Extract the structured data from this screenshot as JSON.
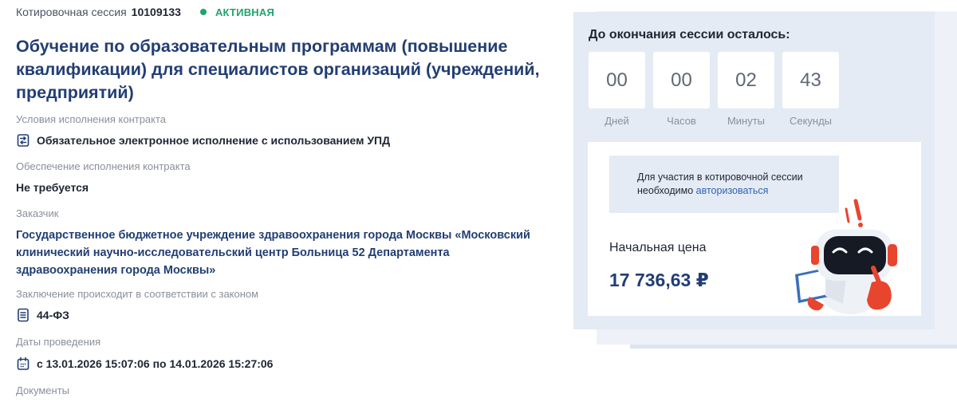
{
  "session": {
    "label": "Котировочная сессия",
    "number": "10109133",
    "status": "АКТИВНАЯ",
    "status_color": "#21a36f"
  },
  "title": "Обучение по образовательным программам (повышение квалификации) для специалистов организаций (учреждений, предприятий)",
  "fields": {
    "conditions": {
      "label": "Условия исполнения контракта",
      "value": "Обязательное электронное исполнение с использованием УПД",
      "icon": "document-exchange-icon"
    },
    "security": {
      "label": "Обеспечение исполнения контракта",
      "value": "Не требуется"
    },
    "customer": {
      "label": "Заказчик",
      "value": "Государственное бюджетное учреждение здравоохранения города Москвы «Московский клинический научно-исследовательский центр Больница 52 Департамента здравоохранения города Москвы»"
    },
    "law": {
      "label": "Заключение происходит в соответствии с законом",
      "value": "44-ФЗ",
      "icon": "document-list-icon"
    },
    "dates": {
      "label": "Даты проведения",
      "value": "с 13.01.2026 15:07:06 по 14.01.2026 15:27:06",
      "icon": "calendar-icon"
    },
    "documents": {
      "label": "Документы"
    }
  },
  "countdown": {
    "title": "До окончания сессии осталось:",
    "units": [
      {
        "value": "00",
        "label": "Дней"
      },
      {
        "value": "00",
        "label": "Часов"
      },
      {
        "value": "02",
        "label": "Минуты"
      },
      {
        "value": "43",
        "label": "Секунды"
      }
    ]
  },
  "participation": {
    "notice_text": "Для участия в котировочной сессии необходимо",
    "notice_link": "авторизоваться"
  },
  "price": {
    "label": "Начальная цена",
    "value": "17 736,63 ₽"
  },
  "colors": {
    "title": "#223e73",
    "panel_bg": "#e4ebf5",
    "link": "#2f63b3",
    "robot_red": "#e8452f"
  }
}
